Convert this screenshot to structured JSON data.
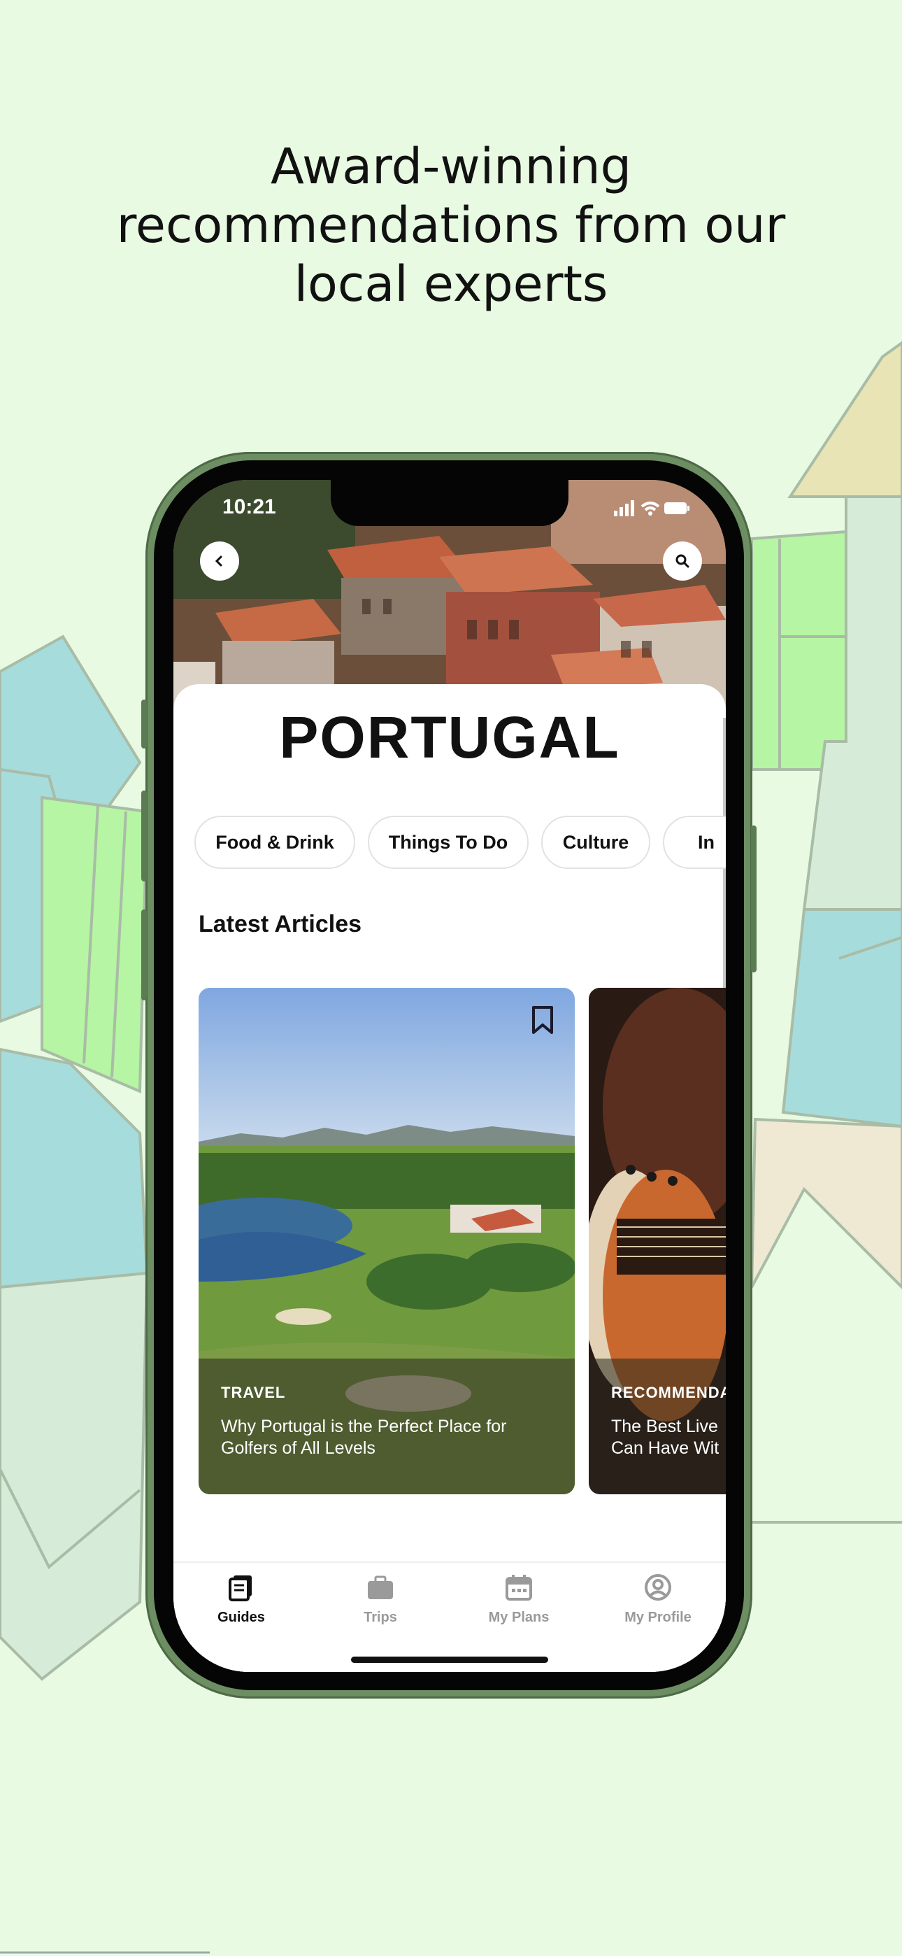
{
  "headline": {
    "line1": "Award-winning",
    "line2": "recommendations from our",
    "line3": "local experts"
  },
  "status_bar": {
    "time": "10:21"
  },
  "icons": {
    "back": "chevron-left-icon",
    "search": "search-icon",
    "bookmark": "bookmark-icon",
    "wifi": "wifi-icon",
    "signal": "signal-icon",
    "battery": "battery-icon"
  },
  "destination": {
    "title": "PORTUGAL"
  },
  "categories": [
    "Food & Drink",
    "Things To Do",
    "Culture",
    "In"
  ],
  "latest": {
    "title": "Latest Articles",
    "articles": [
      {
        "category": "TRAVEL",
        "title": "Why Portugal is the Perfect Place for Golfers of All Levels"
      },
      {
        "category": "RECOMMENDAT",
        "title": "The Best Live Can Have Wit"
      }
    ]
  },
  "tabs": [
    {
      "label": "Guides",
      "icon": "guides-icon",
      "active": true
    },
    {
      "label": "Trips",
      "icon": "briefcase-icon",
      "active": false
    },
    {
      "label": "My Plans",
      "icon": "calendar-icon",
      "active": false
    },
    {
      "label": "My Profile",
      "icon": "profile-icon",
      "active": false
    }
  ],
  "colors": {
    "background": "#e9fae3",
    "phone_frame": "#6c8e62",
    "tab_active": "#111111",
    "tab_inactive": "#9a9a9a"
  }
}
